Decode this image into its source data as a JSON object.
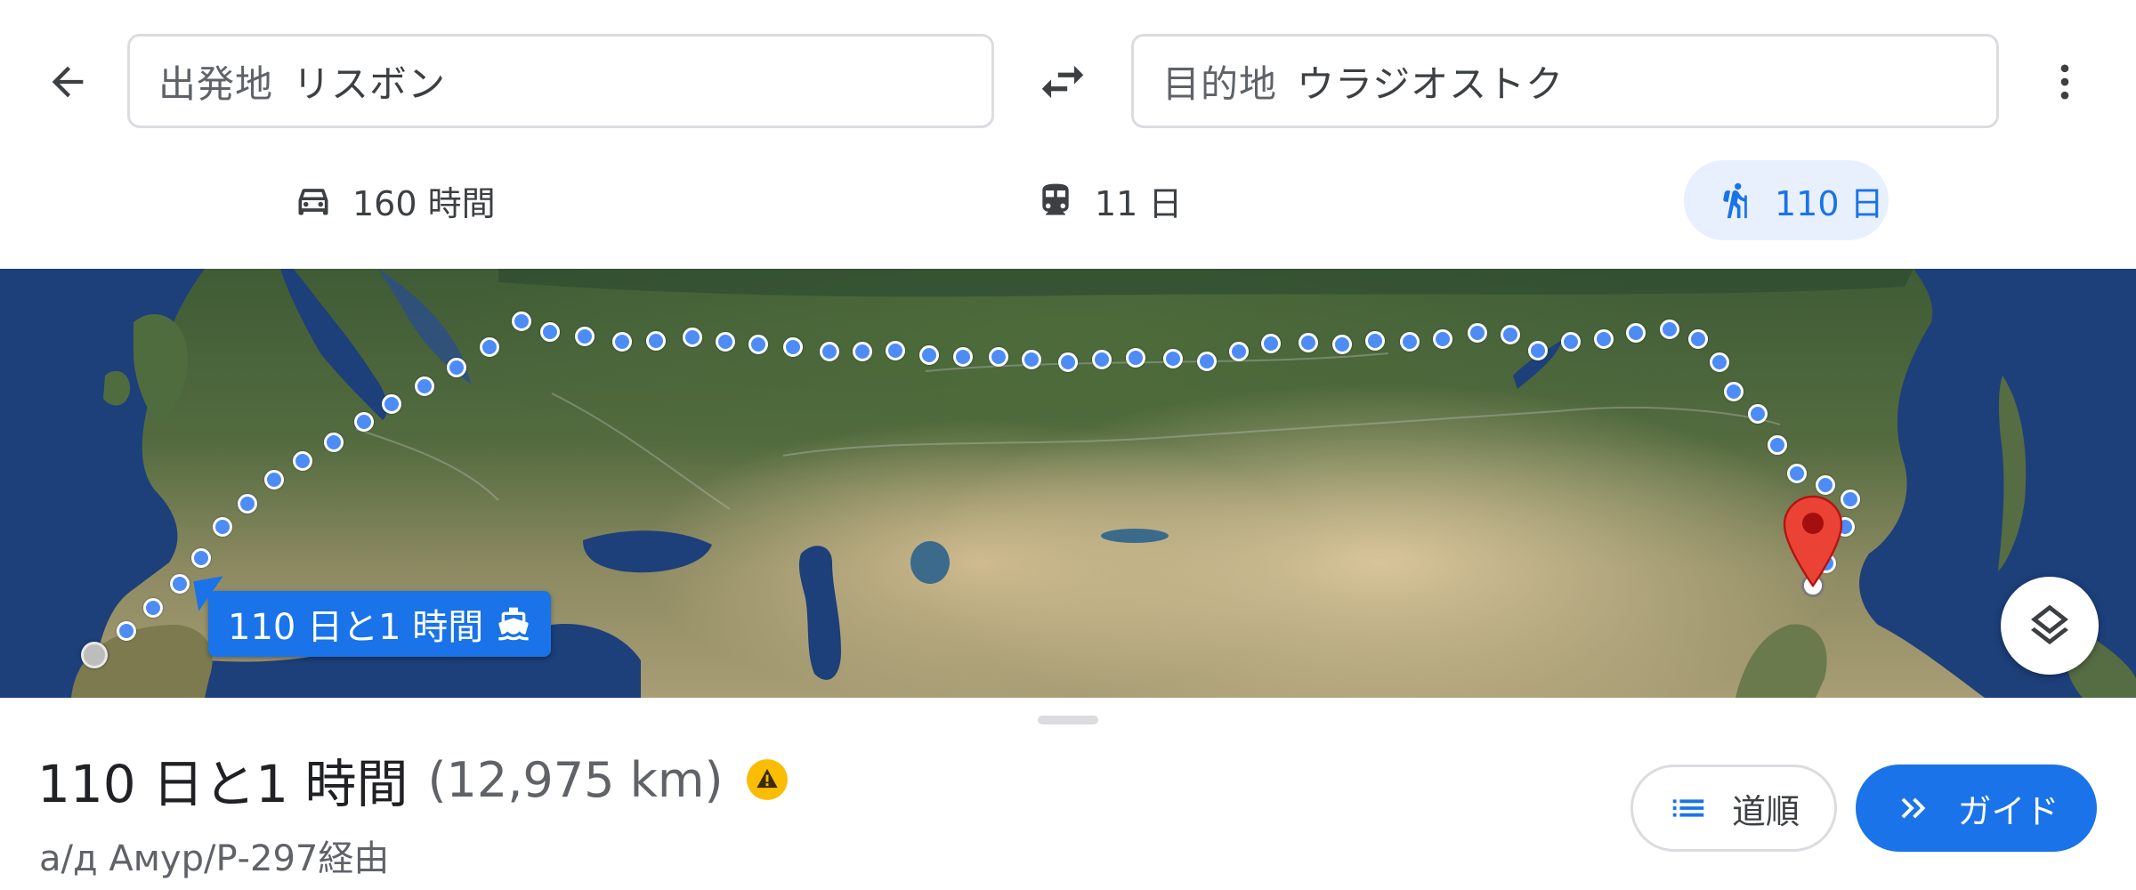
{
  "header": {
    "origin": {
      "label": "出発地",
      "value": "リスボン"
    },
    "destination": {
      "label": "目的地",
      "value": "ウラジオストク"
    }
  },
  "travel_modes": [
    {
      "icon": "car-icon",
      "label": "160 時間",
      "selected": false
    },
    {
      "icon": "train-icon",
      "label": "11 日",
      "selected": false
    },
    {
      "icon": "hiking-icon",
      "label": "110 日",
      "selected": true
    }
  ],
  "map": {
    "route_label": "110 日と1 時間",
    "route_label_icon": "ferry-icon",
    "route_color": "#4d8cf5",
    "pin_color": "#ea4335"
  },
  "summary": {
    "duration": "110 日と1 時間",
    "distance": "(12,975 km)",
    "via": "а/д Амур/Р-297経由",
    "warning_icon": "warning-icon",
    "warning_color": "#fbbc04"
  },
  "actions": {
    "steps_label": "道順",
    "guide_label": "ガイド",
    "accent": "#1a73e8"
  }
}
